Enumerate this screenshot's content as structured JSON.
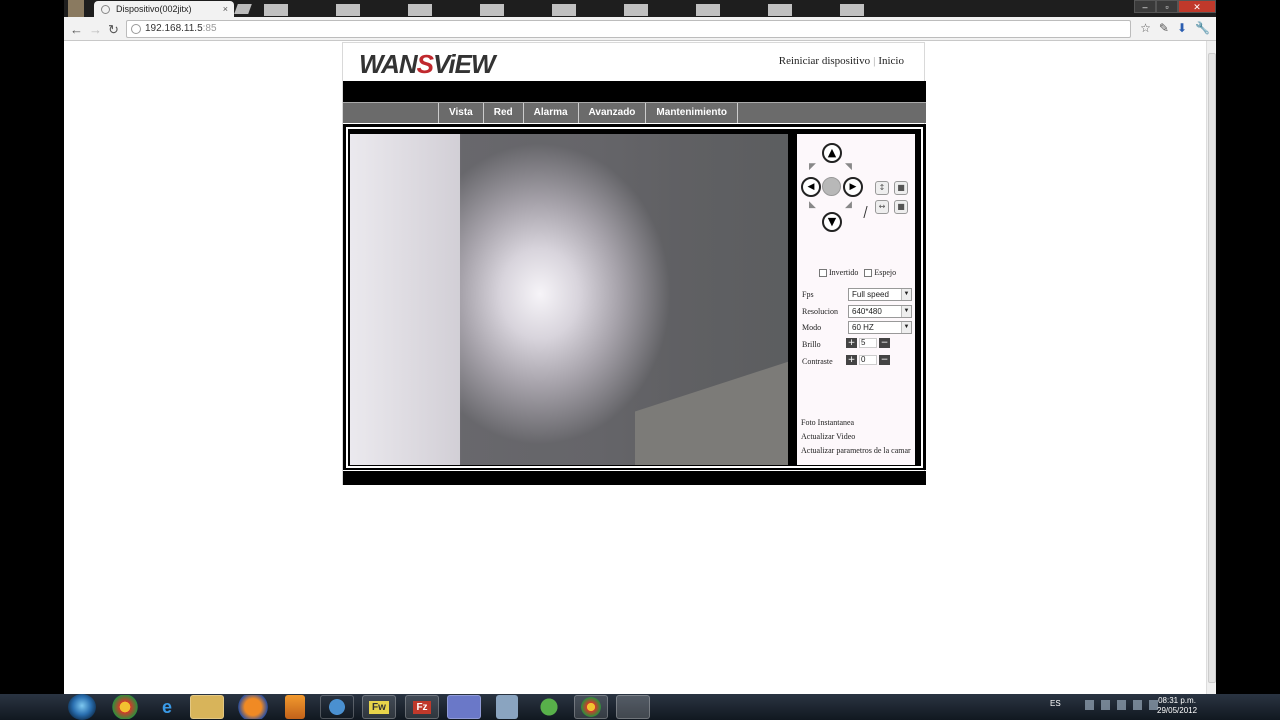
{
  "browser": {
    "tab_title": "Dispositivo(002jitx)",
    "tab_close": "×",
    "url_host": "192.168.11.5",
    "url_port": ":85",
    "nav": {
      "back": "←",
      "forward": "→",
      "reload": "↻"
    },
    "window_buttons": {
      "minimize": "–",
      "maximize": "▫",
      "close": "✕"
    },
    "toolbar_icons": {
      "star": "☆",
      "page": "✎",
      "download": "⬇",
      "wrench": "🔧"
    }
  },
  "camera": {
    "logo_prefix": "WAN",
    "logo_s": "S",
    "logo_suffix": "ViEW",
    "top_links": {
      "reboot": "Reiniciar dispositivo",
      "separator": "|",
      "home": "Inicio"
    },
    "menu": [
      "Vista",
      "Red",
      "Alarma",
      "Avanzado",
      "Mantenimiento"
    ],
    "ptz": {
      "up": "▲",
      "down": "▼",
      "left": "◀",
      "right": "▶",
      "diag_ul": "◤",
      "diag_ur": "◥",
      "diag_dl": "◣",
      "diag_dr": "◢",
      "vflip": "↕",
      "hflip": "↔",
      "stop": "■"
    },
    "checkboxes": {
      "invert": "Invertido",
      "mirror": "Espejo"
    },
    "settings": {
      "fps_label": "Fps",
      "fps_value": "Full speed",
      "resolution_label": "Resolucion",
      "resolution_value": "640*480",
      "mode_label": "Modo",
      "mode_value": "60 HZ",
      "brightness_label": "Brillo",
      "brightness_value": "5",
      "contrast_label": "Contraste",
      "contrast_value": "0",
      "plus": "+",
      "minus": "−",
      "dropdown": "▼"
    },
    "actions": {
      "snapshot": "Foto Instantanea",
      "refresh_video": "Actualizar Video",
      "refresh_params": "Actualizar parametros de la camar"
    }
  },
  "taskbar": {
    "apps": [
      "Chrome",
      "IE",
      "Explorer",
      "Firefox",
      "Media",
      "Thunderbird",
      "Fireworks",
      "FileZilla",
      "Outlook",
      "Calc",
      "Network",
      "Chrome",
      "Camera"
    ],
    "fw_label": "Fw",
    "fz_label": "Fz",
    "lang": "ES",
    "time": "08:31 p.m.",
    "date": "29/05/2012"
  }
}
